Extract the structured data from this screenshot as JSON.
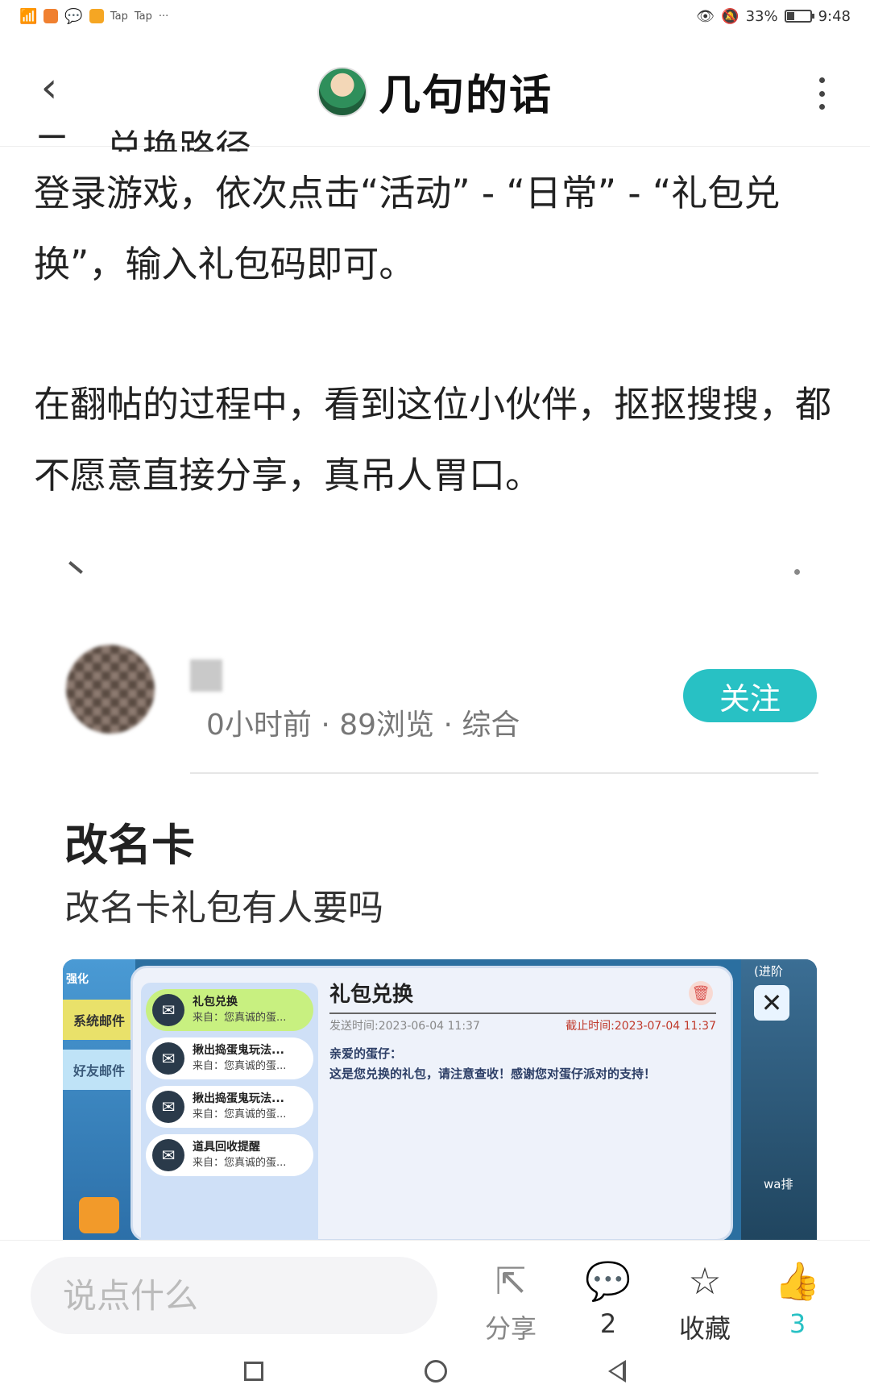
{
  "status_bar": {
    "tap1": "Tap",
    "tap2": "Tap",
    "ellipsis": "···",
    "battery_percent": "33%",
    "battery_level": 0.33,
    "time": "9:48"
  },
  "header": {
    "title": "几句的话"
  },
  "article": {
    "section_heading": "二、兑换路径",
    "paragraph1": "登录游戏，依次点击“活动” - “日常” - “礼包兑换”，输入礼包码即可。",
    "paragraph2": "在翻帖的过程中，看到这位小伙伴，抠抠搜搜，都不愿意直接分享，真吊人胃口。"
  },
  "post": {
    "meta": "0小时前 · 89浏览 · 综合",
    "follow_label": "关注",
    "title": "改名卡",
    "body": "改名卡礼包有人要吗",
    "game": {
      "left_tab1": "强化",
      "left_tab2": "系统邮件",
      "left_tab3": "好友邮件",
      "right_label": "(进阶",
      "right_label2": "wa排",
      "mails": [
        {
          "title": "礼包兑换",
          "from": "来自：您真诚的蛋...",
          "active": true
        },
        {
          "title": "揪出捣蛋鬼玩法...",
          "from": "来自：您真诚的蛋...",
          "active": false
        },
        {
          "title": "揪出捣蛋鬼玩法...",
          "from": "来自：您真诚的蛋...",
          "active": false
        },
        {
          "title": "道具回收提醒",
          "from": "来自：您真诚的蛋...",
          "active": false
        }
      ],
      "detail_title": "礼包兑换",
      "send_time": "发送时间:2023-06-04 11:37",
      "deadline": "截止时间:2023-07-04 11:37",
      "greeting": "亲爱的蛋仔：",
      "message": "这是您兑换的礼包，请注意查收！感谢您对蛋仔派对的支持！"
    }
  },
  "bottom_bar": {
    "comment_placeholder": "说点什么",
    "share_label": "分享",
    "comment_count": "2",
    "favorite_label": "收藏",
    "like_count": "3"
  }
}
